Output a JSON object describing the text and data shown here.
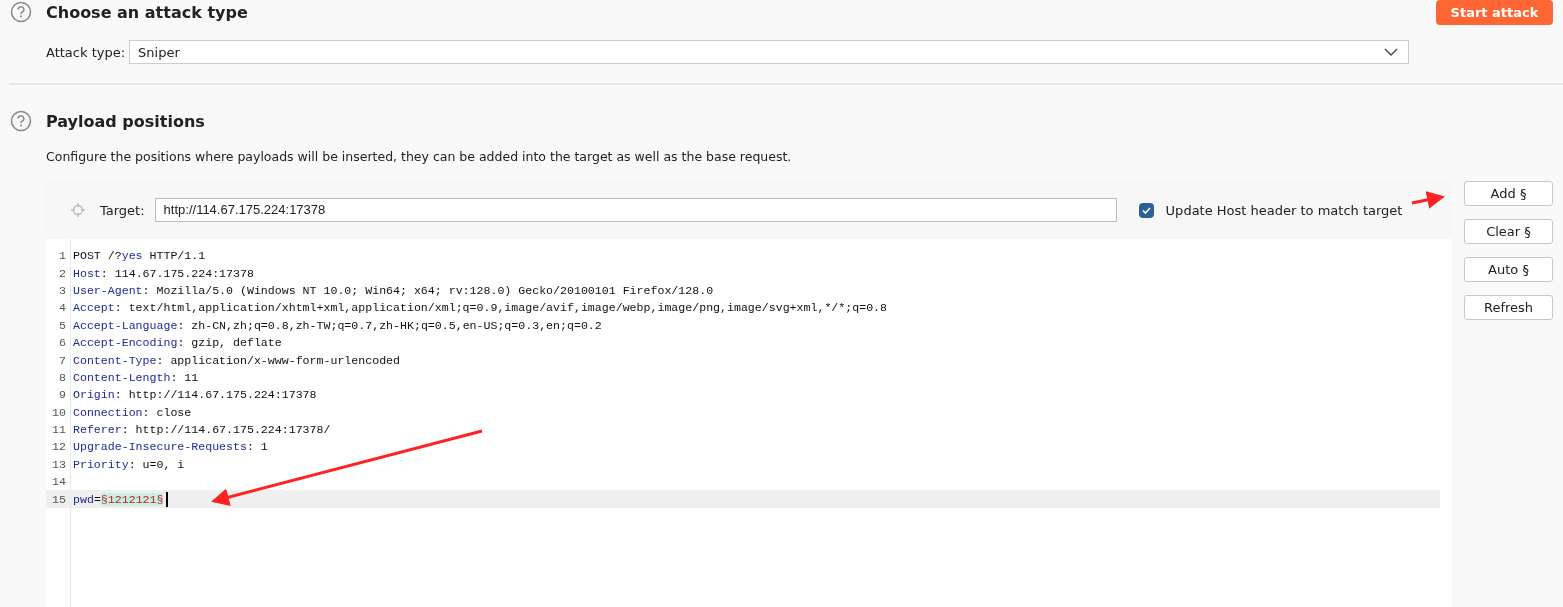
{
  "attack_section": {
    "title": "Choose an attack type",
    "start_button": "Start attack",
    "attack_type": {
      "label": "Attack type:",
      "value": "Sniper"
    }
  },
  "positions_section": {
    "title": "Payload positions",
    "description": "Configure the positions where payloads will be inserted, they can be added into the target as well as the base request.",
    "target": {
      "label": "Target:",
      "value": "http://114.67.175.224:17378"
    },
    "update_host": {
      "label": "Update Host header to match target",
      "checked": true
    },
    "buttons": [
      "Add §",
      "Clear §",
      "Auto §",
      "Refresh"
    ],
    "request_lines": [
      {
        "number": "1",
        "segments": [
          {
            "kind": "plain",
            "text": "POST /?"
          },
          {
            "kind": "key",
            "text": "yes"
          },
          {
            "kind": "plain",
            "text": " HTTP/1.1"
          }
        ]
      },
      {
        "number": "2",
        "segments": [
          {
            "kind": "key",
            "text": "Host"
          },
          {
            "kind": "plain",
            "text": ": 114.67.175.224:17378"
          }
        ]
      },
      {
        "number": "3",
        "segments": [
          {
            "kind": "key",
            "text": "User-Agent"
          },
          {
            "kind": "plain",
            "text": ": Mozilla/5.0 (Windows NT 10.0; Win64; x64; rv:128.0) Gecko/20100101 Firefox/128.0"
          }
        ]
      },
      {
        "number": "4",
        "segments": [
          {
            "kind": "key",
            "text": "Accept"
          },
          {
            "kind": "plain",
            "text": ": text/html,application/xhtml+xml,application/xml;q=0.9,image/avif,image/webp,image/png,image/svg+xml,*/*;q=0.8"
          }
        ]
      },
      {
        "number": "5",
        "segments": [
          {
            "kind": "key",
            "text": "Accept-Language"
          },
          {
            "kind": "plain",
            "text": ": zh-CN,zh;q=0.8,zh-TW;q=0.7,zh-HK;q=0.5,en-US;q=0.3,en;q=0.2"
          }
        ]
      },
      {
        "number": "6",
        "segments": [
          {
            "kind": "key",
            "text": "Accept-Encoding"
          },
          {
            "kind": "plain",
            "text": ": gzip, deflate"
          }
        ]
      },
      {
        "number": "7",
        "segments": [
          {
            "kind": "key",
            "text": "Content-Type"
          },
          {
            "kind": "plain",
            "text": ": application/x-www-form-urlencoded"
          }
        ]
      },
      {
        "number": "8",
        "segments": [
          {
            "kind": "key",
            "text": "Content-Length"
          },
          {
            "kind": "plain",
            "text": ": 11"
          }
        ]
      },
      {
        "number": "9",
        "segments": [
          {
            "kind": "key",
            "text": "Origin"
          },
          {
            "kind": "plain",
            "text": ": http://114.67.175.224:17378"
          }
        ]
      },
      {
        "number": "10",
        "segments": [
          {
            "kind": "key",
            "text": "Connection"
          },
          {
            "kind": "plain",
            "text": ": close"
          }
        ]
      },
      {
        "number": "11",
        "segments": [
          {
            "kind": "key",
            "text": "Referer"
          },
          {
            "kind": "plain",
            "text": ": http://114.67.175.224:17378/"
          }
        ]
      },
      {
        "number": "12",
        "segments": [
          {
            "kind": "key",
            "text": "Upgrade-Insecure-Requests"
          },
          {
            "kind": "plain",
            "text": ": 1"
          }
        ]
      },
      {
        "number": "13",
        "segments": [
          {
            "kind": "key",
            "text": "Priority"
          },
          {
            "kind": "plain",
            "text": ": u=0, i"
          }
        ]
      },
      {
        "number": "14"
      },
      {
        "number": "15",
        "current": true,
        "segments": [
          {
            "kind": "key",
            "text": "pwd"
          },
          {
            "kind": "plain",
            "text": "="
          },
          {
            "kind": "payload",
            "text": "§1212121§"
          }
        ]
      }
    ]
  },
  "annotations": [
    {
      "kind": "arrow"
    },
    {
      "kind": "arrow"
    }
  ]
}
